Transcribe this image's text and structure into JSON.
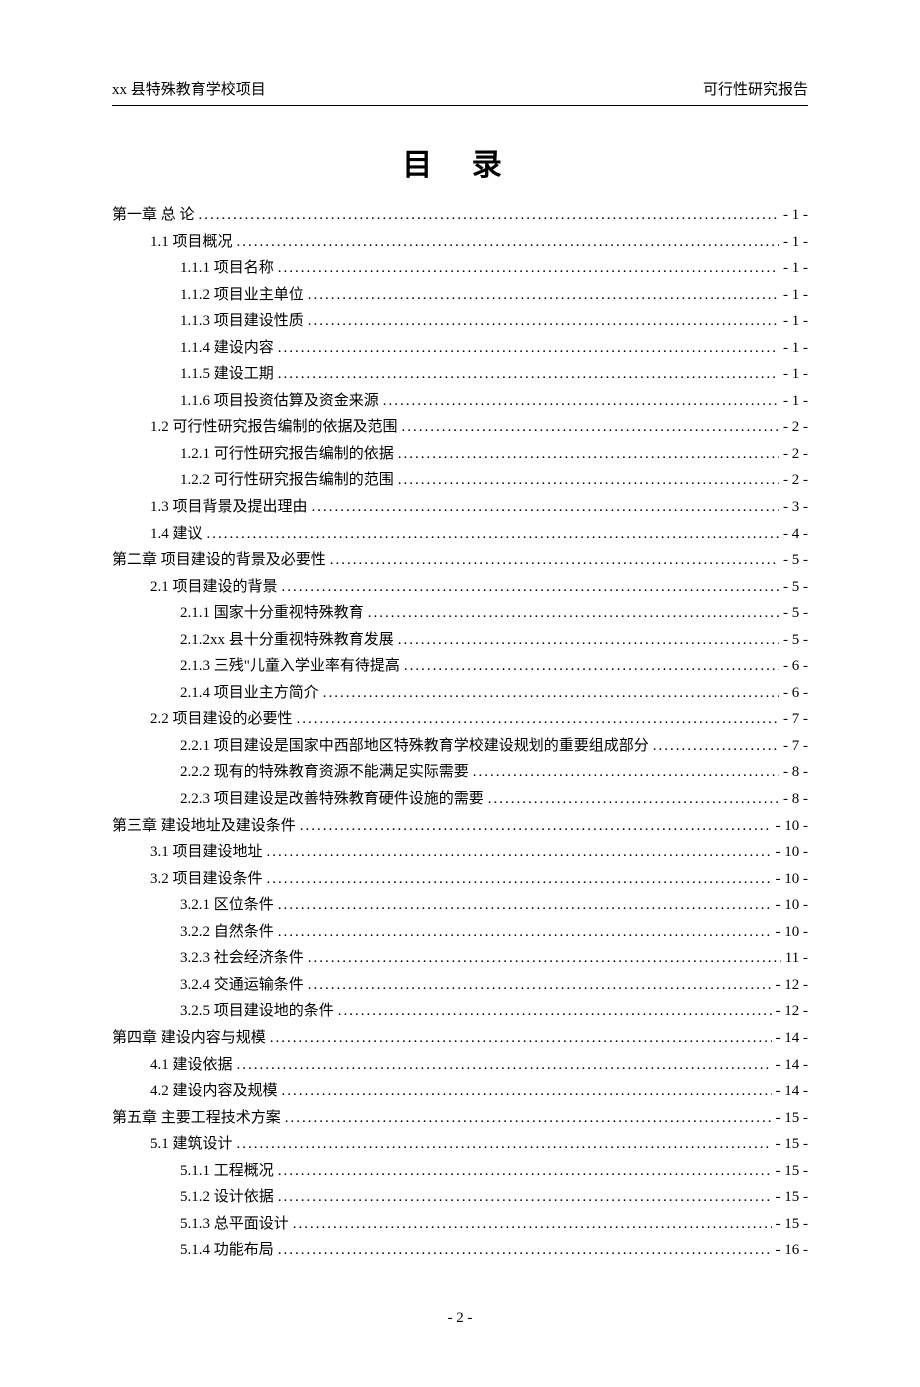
{
  "header": {
    "left": "xx 县特殊教育学校项目",
    "right": "可行性研究报告"
  },
  "title": "目 录",
  "toc": [
    {
      "level": 1,
      "label": "第一章  总  论",
      "page": "- 1 -"
    },
    {
      "level": 2,
      "label": "1.1 项目概况",
      "page": "- 1 -"
    },
    {
      "level": 3,
      "label": "1.1.1 项目名称",
      "page": "- 1 -"
    },
    {
      "level": 3,
      "label": "1.1.2 项目业主单位",
      "page": "- 1 -"
    },
    {
      "level": 3,
      "label": "1.1.3 项目建设性质",
      "page": "- 1 -"
    },
    {
      "level": 3,
      "label": "1.1.4 建设内容",
      "page": "- 1 -"
    },
    {
      "level": 3,
      "label": "1.1.5 建设工期",
      "page": "- 1 -"
    },
    {
      "level": 3,
      "label": "1.1.6 项目投资估算及资金来源",
      "page": "- 1 -"
    },
    {
      "level": 2,
      "label": "1.2 可行性研究报告编制的依据及范围",
      "page": "- 2 -"
    },
    {
      "level": 3,
      "label": "1.2.1 可行性研究报告编制的依据",
      "page": "- 2 -"
    },
    {
      "level": 3,
      "label": "1.2.2 可行性研究报告编制的范围",
      "page": "- 2 -"
    },
    {
      "level": 2,
      "label": "1.3 项目背景及提出理由",
      "page": "- 3 -"
    },
    {
      "level": 2,
      "label": "1.4 建议",
      "page": "- 4 -"
    },
    {
      "level": 1,
      "label": "第二章  项目建设的背景及必要性",
      "page": "- 5 -"
    },
    {
      "level": 2,
      "label": "2.1 项目建设的背景",
      "page": "- 5 -"
    },
    {
      "level": 3,
      "label": "2.1.1 国家十分重视特殊教育",
      "page": "- 5 -"
    },
    {
      "level": 3,
      "label": "2.1.2xx 县十分重视特殊教育发展",
      "page": "- 5 -"
    },
    {
      "level": 3,
      "label": "2.1.3 三残\"儿童入学业率有待提高",
      "page": "- 6 -"
    },
    {
      "level": 3,
      "label": "2.1.4 项目业主方简介",
      "page": "- 6 -"
    },
    {
      "level": 2,
      "label": "2.2 项目建设的必要性",
      "page": "- 7 -"
    },
    {
      "level": 3,
      "label": "2.2.1 项目建设是国家中西部地区特殊教育学校建设规划的重要组成部分",
      "page": "- 7 -"
    },
    {
      "level": 3,
      "label": "2.2.2 现有的特殊教育资源不能满足实际需要",
      "page": "- 8 -"
    },
    {
      "level": 3,
      "label": "2.2.3 项目建设是改善特殊教育硬件设施的需要",
      "page": "- 8 -"
    },
    {
      "level": 1,
      "label": "第三章 建设地址及建设条件",
      "page": "- 10 -"
    },
    {
      "level": 2,
      "label": "3.1 项目建设地址",
      "page": "- 10 -"
    },
    {
      "level": 2,
      "label": "3.2 项目建设条件",
      "page": "- 10 -"
    },
    {
      "level": 3,
      "label": "3.2.1 区位条件",
      "page": "- 10 -"
    },
    {
      "level": 3,
      "label": "3.2.2 自然条件",
      "page": "- 10 -"
    },
    {
      "level": 3,
      "label": "3.2.3 社会经济条件",
      "page": " 11 -"
    },
    {
      "level": 3,
      "label": "3.2.4 交通运输条件",
      "page": "- 12 -"
    },
    {
      "level": 3,
      "label": "3.2.5 项目建设地的条件",
      "page": "- 12 -"
    },
    {
      "level": 1,
      "label": "第四章 建设内容与规模",
      "page": "- 14 -"
    },
    {
      "level": 2,
      "label": "4.1 建设依据",
      "page": "- 14 -"
    },
    {
      "level": 2,
      "label": "4.2 建设内容及规模",
      "page": "- 14 -"
    },
    {
      "level": 1,
      "label": "第五章   主要工程技术方案",
      "page": "- 15 -"
    },
    {
      "level": 2,
      "label": "5.1 建筑设计",
      "page": "- 15 -"
    },
    {
      "level": 3,
      "label": "5.1.1 工程概况",
      "page": "- 15 -"
    },
    {
      "level": 3,
      "label": "5.1.2 设计依据",
      "page": "- 15 -"
    },
    {
      "level": 3,
      "label": "5.1.3 总平面设计",
      "page": "- 15 -"
    },
    {
      "level": 3,
      "label": "5.1.4 功能布局",
      "page": "- 16 -"
    }
  ],
  "page_number": "- 2 -"
}
